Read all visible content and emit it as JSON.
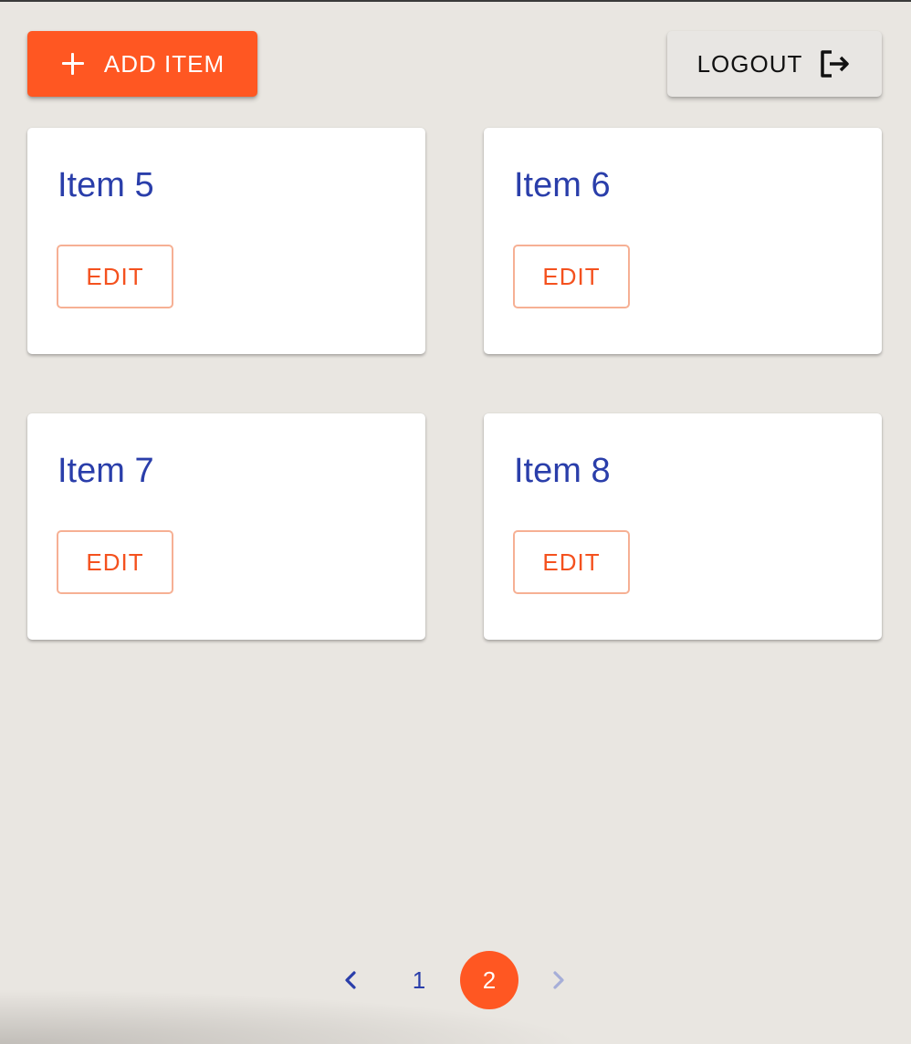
{
  "toolbar": {
    "add_label": "ADD ITEM",
    "add_icon": "plus-icon",
    "logout_label": "LOGOUT",
    "logout_icon": "logout-icon"
  },
  "items": [
    {
      "title": "Item 5",
      "edit_label": "EDIT"
    },
    {
      "title": "Item 6",
      "edit_label": "EDIT"
    },
    {
      "title": "Item 7",
      "edit_label": "EDIT"
    },
    {
      "title": "Item 8",
      "edit_label": "EDIT"
    }
  ],
  "pagination": {
    "pages": [
      "1",
      "2"
    ],
    "current": "2",
    "prev_icon": "chevron-left-icon",
    "next_icon": "chevron-right-icon"
  },
  "colors": {
    "accent": "#ff5722",
    "title": "#2a3eaa",
    "background": "#e9e6e1"
  }
}
